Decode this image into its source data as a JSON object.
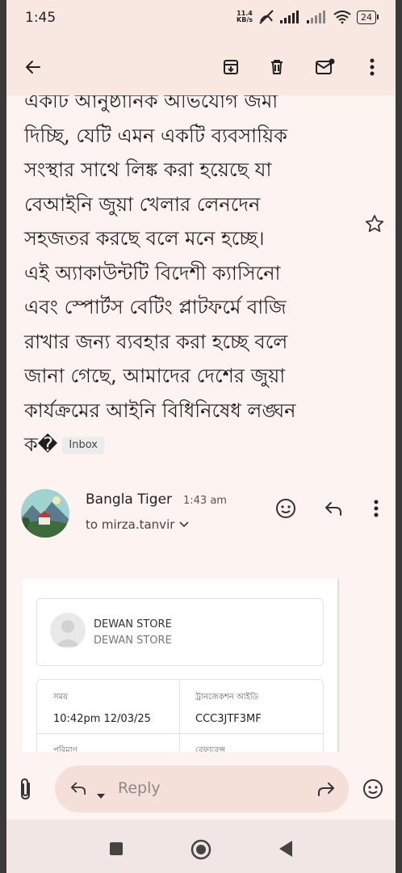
{
  "status_bar": {
    "time": "1:45",
    "net_speed_value": "11.4",
    "net_speed_unit": "KB/s",
    "battery": "24"
  },
  "email": {
    "subject_lines": [
      "একটি আনুষ্ঠানিক অভিযোগ জমা",
      "দিচ্ছি, যেটি এমন একটি ব্যবসায়িক",
      "সংস্থার সাথে লিঙ্ক করা হয়েছে যা",
      "বেআইনি জুয়া খেলার লেনদেন",
      "সহজতর করছে বলে মনে হচ্ছে।",
      "এই অ্যাকাউন্টটি বিদেশী ক্যাসিনো",
      "এবং স্পোর্টস বেটিং প্লাটফর্মে বাজি",
      "রাখার জন্য ব্যবহার করা হচ্ছে বলে",
      "জানা গেছে, আমাদের দেশের জুয়া",
      "কার্যক্রমের আইনি বিধিনিষেধ লঙ্ঘন",
      "ক�"
    ],
    "label_chip": "Inbox",
    "sender_name": "Bangla Tiger",
    "sent_time": "1:43 am",
    "recipient": "to mirza.tanvir"
  },
  "receipt": {
    "store_name": "DEWAN STORE",
    "store_subtitle": "DEWAN STORE",
    "time_label": "সময়",
    "time_value": "10:42pm 12/03/25",
    "txn_label": "ট্রানজেকশন আইডি",
    "txn_value": "CCC3JTF3MF",
    "amount_label": "পরিমাণ",
    "reference_label": "রেফারেন্স"
  },
  "reply_bar": {
    "reply_label": "Reply"
  },
  "icons": {
    "back": "arrow-left-icon",
    "archive": "archive-icon",
    "delete": "trash-icon",
    "mark_unread": "mail-unread-icon",
    "more": "more-vert-icon",
    "star": "star-icon",
    "emoji": "emoji-icon",
    "reply": "reply-icon",
    "attach": "paperclip-icon",
    "forward": "forward-icon"
  },
  "colors": {
    "app_background": "#fdf3f0",
    "top_bar": "#f9e7e1",
    "reply_pill": "#f5e0d9"
  }
}
